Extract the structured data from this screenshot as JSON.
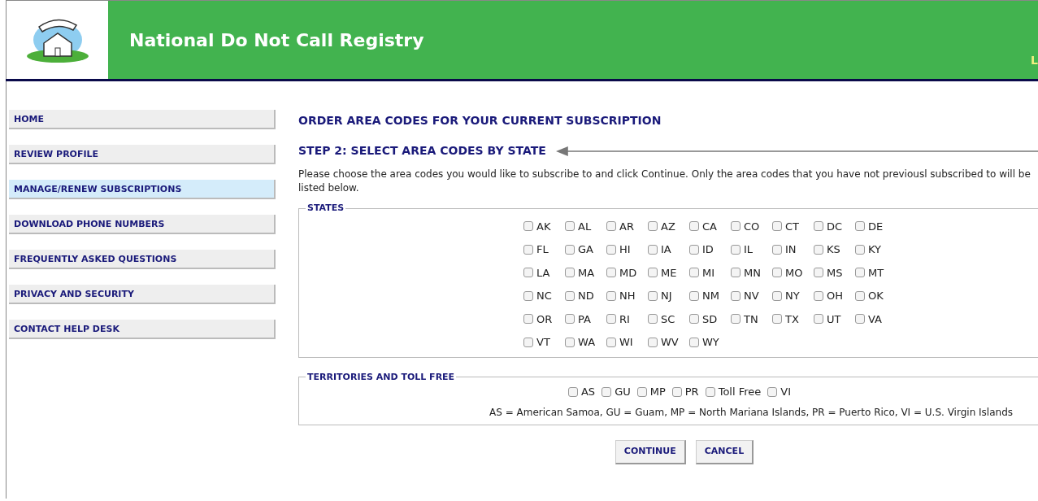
{
  "header": {
    "title": "National Do Not Call Registry",
    "corner_text": "L"
  },
  "sidebar": {
    "items": [
      {
        "label": "HOME",
        "selected": false
      },
      {
        "label": "REVIEW PROFILE",
        "selected": false
      },
      {
        "label": "MANAGE/RENEW SUBSCRIPTIONS",
        "selected": true
      },
      {
        "label": "DOWNLOAD PHONE NUMBERS",
        "selected": false
      },
      {
        "label": "FREQUENTLY ASKED QUESTIONS",
        "selected": false
      },
      {
        "label": "PRIVACY AND SECURITY",
        "selected": false
      },
      {
        "label": "CONTACT HELP DESK",
        "selected": false
      }
    ]
  },
  "main": {
    "heading": "ORDER AREA CODES FOR YOUR CURRENT SUBSCRIPTION",
    "step_heading": "STEP 2: SELECT AREA CODES BY STATE",
    "instructions": "Please choose the area codes you would like to subscribe to and click Continue. Only the area codes that you have not previousl subscribed to will be listed below.",
    "states": {
      "legend": "STATES",
      "options": [
        {
          "label": "AK",
          "checked": false
        },
        {
          "label": "AL",
          "checked": false
        },
        {
          "label": "AR",
          "checked": false
        },
        {
          "label": "AZ",
          "checked": false
        },
        {
          "label": "CA",
          "checked": false
        },
        {
          "label": "CO",
          "checked": false
        },
        {
          "label": "CT",
          "checked": false
        },
        {
          "label": "DC",
          "checked": false
        },
        {
          "label": "DE",
          "checked": false
        },
        {
          "label": "FL",
          "checked": false
        },
        {
          "label": "GA",
          "checked": false
        },
        {
          "label": "HI",
          "checked": false
        },
        {
          "label": "IA",
          "checked": false
        },
        {
          "label": "ID",
          "checked": false
        },
        {
          "label": "IL",
          "checked": false
        },
        {
          "label": "IN",
          "checked": false
        },
        {
          "label": "KS",
          "checked": false
        },
        {
          "label": "KY",
          "checked": false
        },
        {
          "label": "LA",
          "checked": false
        },
        {
          "label": "MA",
          "checked": false
        },
        {
          "label": "MD",
          "checked": false
        },
        {
          "label": "ME",
          "checked": false
        },
        {
          "label": "MI",
          "checked": false
        },
        {
          "label": "MN",
          "checked": false
        },
        {
          "label": "MO",
          "checked": false
        },
        {
          "label": "MS",
          "checked": false
        },
        {
          "label": "MT",
          "checked": false
        },
        {
          "label": "NC",
          "checked": false
        },
        {
          "label": "ND",
          "checked": false
        },
        {
          "label": "NH",
          "checked": false
        },
        {
          "label": "NJ",
          "checked": false
        },
        {
          "label": "NM",
          "checked": false
        },
        {
          "label": "NV",
          "checked": false
        },
        {
          "label": "NY",
          "checked": false
        },
        {
          "label": "OH",
          "checked": false
        },
        {
          "label": "OK",
          "checked": false
        },
        {
          "label": "OR",
          "checked": false
        },
        {
          "label": "PA",
          "checked": false
        },
        {
          "label": "RI",
          "checked": false
        },
        {
          "label": "SC",
          "checked": false
        },
        {
          "label": "SD",
          "checked": false
        },
        {
          "label": "TN",
          "checked": false
        },
        {
          "label": "TX",
          "checked": false
        },
        {
          "label": "UT",
          "checked": false
        },
        {
          "label": "VA",
          "checked": false
        },
        {
          "label": "VT",
          "checked": false
        },
        {
          "label": "WA",
          "checked": false
        },
        {
          "label": "WI",
          "checked": false
        },
        {
          "label": "WV",
          "checked": false
        },
        {
          "label": "WY",
          "checked": false
        }
      ]
    },
    "territories": {
      "legend": "TERRITORIES AND TOLL FREE",
      "options": [
        {
          "label": "AS",
          "checked": false
        },
        {
          "label": "GU",
          "checked": false
        },
        {
          "label": "MP",
          "checked": false
        },
        {
          "label": "PR",
          "checked": false
        },
        {
          "label": "Toll Free",
          "checked": false
        },
        {
          "label": "VI",
          "checked": false
        }
      ],
      "note": "AS = American Samoa, GU = Guam, MP = North Mariana Islands, PR = Puerto Rico, VI = U.S. Virgin Islands"
    },
    "buttons": [
      "CONTINUE",
      "CANCEL"
    ]
  }
}
